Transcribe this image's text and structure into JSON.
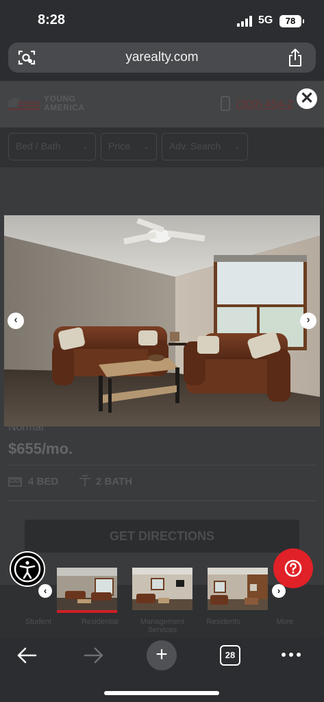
{
  "status_bar": {
    "time": "8:28",
    "network": "5G",
    "battery": "78"
  },
  "browser": {
    "url": "yarealty.com",
    "tab_count": "28"
  },
  "site": {
    "logo_line1": "YOUNG",
    "logo_line2": "AMERICA",
    "phone": "(309) 454-2"
  },
  "filters": [
    {
      "label": "Bed /  Bath"
    },
    {
      "label": "Price"
    },
    {
      "label": "Adv. Search"
    }
  ],
  "listing": {
    "city": "Normal",
    "price": "$655/mo.",
    "beds": "4 BED",
    "baths": "2 BATH",
    "directions_label": "GET DIRECTIONS"
  },
  "bottom_nav": [
    {
      "label": "Student"
    },
    {
      "label": "Residential"
    },
    {
      "label": "Management Services"
    },
    {
      "label": "Residents"
    },
    {
      "label": "More"
    }
  ],
  "icons": {
    "close": "close-icon",
    "prev": "chevron-left-icon",
    "next": "chevron-right-icon",
    "help": "question-icon",
    "accessibility": "accessibility-icon"
  },
  "colors": {
    "accent_red": "#e02127",
    "overlay_bg": "#2b2d30",
    "url_bar": "#484a4d"
  }
}
